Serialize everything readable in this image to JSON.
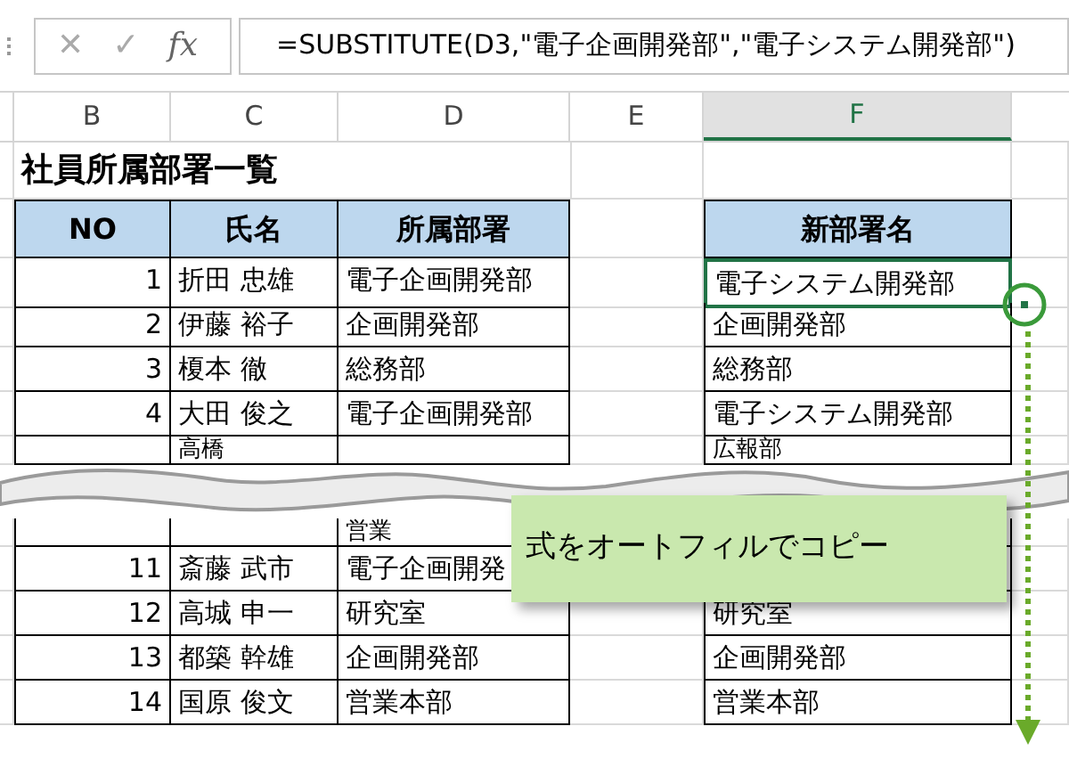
{
  "formula_bar": {
    "cancel": "✕",
    "enter": "✓",
    "function": "fx",
    "formula": "=SUBSTITUTE(D3,\"電子企画開発部\",\"電子システム開発部\")"
  },
  "column_headers": [
    {
      "label": "B",
      "selected": false
    },
    {
      "label": "C",
      "selected": false
    },
    {
      "label": "D",
      "selected": false
    },
    {
      "label": "E",
      "selected": false
    },
    {
      "label": "F",
      "selected": true
    }
  ],
  "title": "社員所属部署一覧",
  "table": {
    "columns": [
      "NO",
      "氏名",
      "所属部署"
    ],
    "new_column": "新部署名"
  },
  "rows": [
    {
      "kind": "full",
      "no": "1",
      "name": "折田 忠雄",
      "dept": "電子企画開発部",
      "new_dept": "電子システム開発部",
      "active": true
    },
    {
      "kind": "full",
      "no": "2",
      "name": "伊藤 裕子",
      "dept": "企画開発部",
      "new_dept": "企画開発部",
      "active": false
    },
    {
      "kind": "full",
      "no": "3",
      "name": "榎本 徹",
      "dept": "総務部",
      "new_dept": "総務部",
      "active": false
    },
    {
      "kind": "full",
      "no": "4",
      "name": "大田 俊之",
      "dept": "電子企画開発部",
      "new_dept": "電子システム開発部",
      "active": false
    },
    {
      "kind": "fragment",
      "name": "高橋",
      "new_dept": "広報部",
      "active": false
    },
    {
      "kind": "tear"
    },
    {
      "kind": "fragment",
      "dept": "営業",
      "active": false
    },
    {
      "kind": "full",
      "no": "11",
      "name": "斎藤 武市",
      "dept": "電子企画開発",
      "active": false
    },
    {
      "kind": "full",
      "no": "12",
      "name": "高城 申一",
      "dept": "研究室",
      "new_dept": "研究室",
      "active": false
    },
    {
      "kind": "full",
      "no": "13",
      "name": "都築 幹雄",
      "dept": "企画開発部",
      "new_dept": "企画開発部",
      "active": false
    },
    {
      "kind": "full",
      "no": "14",
      "name": "国原 俊文",
      "dept": "営業本部",
      "new_dept": "営業本部",
      "active": false
    }
  ],
  "callout": {
    "text": "式をオートフィルでコピー"
  }
}
